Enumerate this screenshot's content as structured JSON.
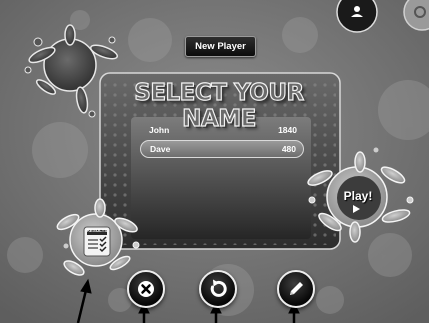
{
  "header": {
    "new_player_label": "New Player"
  },
  "main": {
    "title": "SELECT YOUR NAME",
    "players": [
      {
        "name": "John",
        "score": "1840",
        "selected": false
      },
      {
        "name": "Dave",
        "score": "480",
        "selected": true
      }
    ]
  },
  "play": {
    "label": "Play!"
  },
  "results": {
    "label": "RESULTS"
  },
  "icons": {
    "profile": "profile-icon",
    "settings": "gear-icon",
    "results": "results-checklist-icon",
    "delete": "delete-x-icon",
    "reset": "refresh-icon",
    "edit": "pencil-icon",
    "play": "play-triangle-icon"
  },
  "colors": {
    "background": "#777777",
    "panel": "#4e4e4e",
    "button": "#0c0c0c",
    "text": "#ffffff"
  }
}
